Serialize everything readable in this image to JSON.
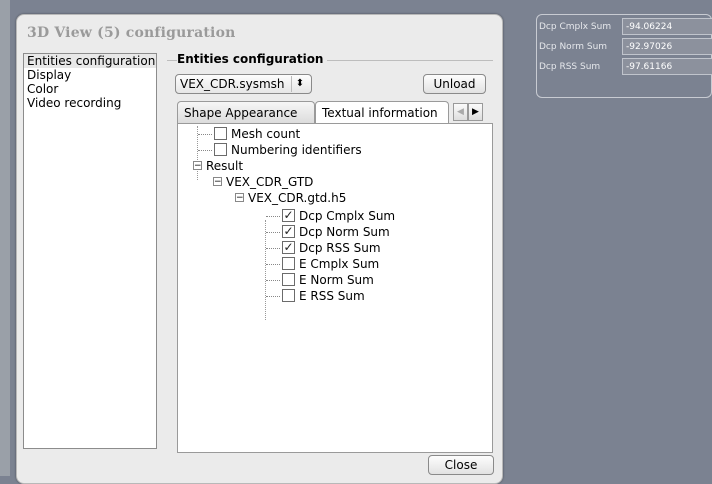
{
  "dialog": {
    "title": "3D View (5) configuration",
    "nav_items": [
      "Entities configuration",
      "Display",
      "Color",
      "Video recording"
    ],
    "group_title": "Entities configuration",
    "mesh_select": "VEX_CDR.sysmsh",
    "unload_label": "Unload",
    "tabs": [
      "Shape Appearance",
      "Textual information"
    ],
    "close_label": "Close",
    "tree": {
      "mesh_count": "Mesh count",
      "numbering": "Numbering identifiers",
      "result": "Result",
      "gtd": "VEX_CDR_GTD",
      "h5": "VEX_CDR.gtd.h5",
      "items": [
        {
          "label": "Dcp Cmplx Sum",
          "checked": true
        },
        {
          "label": "Dcp Norm Sum",
          "checked": true
        },
        {
          "label": "Dcp RSS Sum",
          "checked": true
        },
        {
          "label": "E Cmplx Sum",
          "checked": false
        },
        {
          "label": "E Norm Sum",
          "checked": false
        },
        {
          "label": "E RSS Sum",
          "checked": false
        }
      ]
    }
  },
  "readout": {
    "rows": [
      {
        "label": "Dcp Cmplx Sum",
        "value": "-94.06224"
      },
      {
        "label": "Dcp Norm Sum",
        "value": "-92.97026"
      },
      {
        "label": "Dcp RSS Sum",
        "value": "-97.61166"
      }
    ]
  }
}
